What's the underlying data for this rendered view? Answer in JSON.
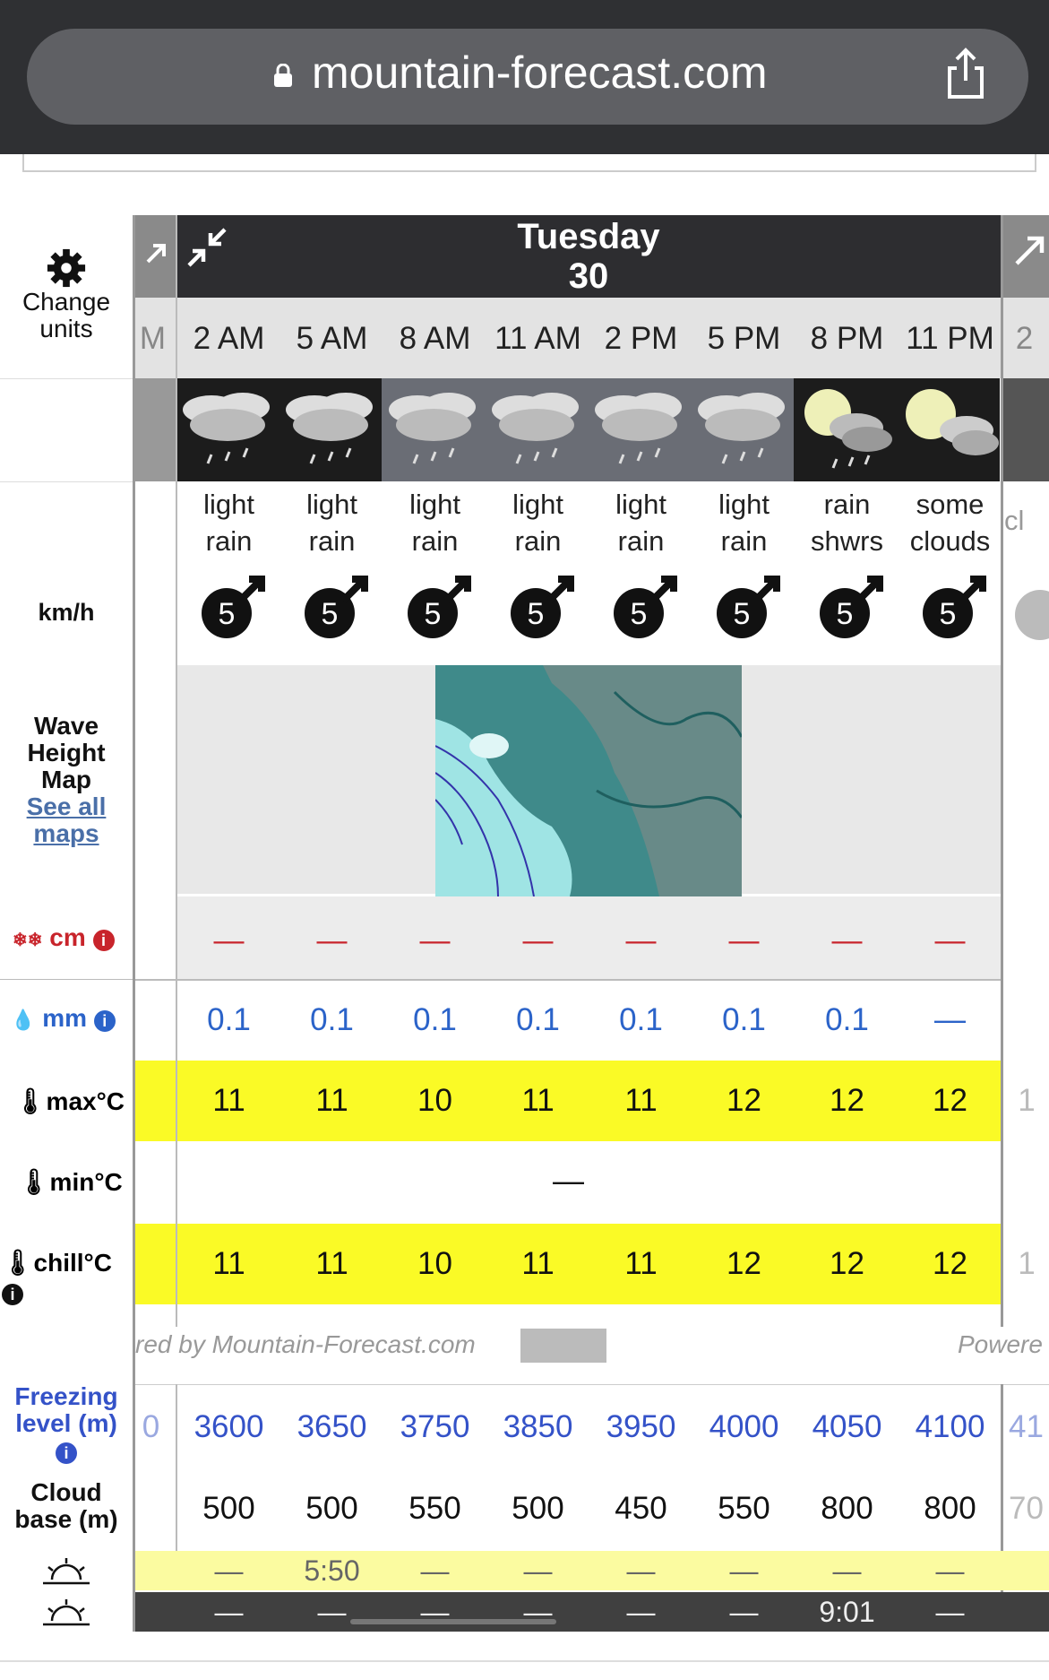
{
  "browser": {
    "url": "mountain-forecast.com"
  },
  "left_labels": {
    "change": "Change",
    "units": "units",
    "wind_unit": "km/h",
    "wave1": "Wave",
    "wave2": "Height",
    "wave3": "Map",
    "see_all1": "See all",
    "see_all2": "maps",
    "snow_unit": "cm",
    "rain_unit": "mm",
    "max_temp": "max°C",
    "min_temp": "min°C",
    "chill": "chill°C",
    "freezing1": "Freezing",
    "freezing2": "level (m)",
    "cloud1": "Cloud",
    "cloud2": "base (m)"
  },
  "day": {
    "name": "Tuesday",
    "number": "30"
  },
  "times": [
    "2 AM",
    "5 AM",
    "8 AM",
    "11 AM",
    "2 PM",
    "5 PM",
    "8 PM",
    "11 PM"
  ],
  "edge_labels": {
    "left_time": "M",
    "right_time": "2",
    "right_desc": "cl",
    "right_temp": "1",
    "left_freeze": "0",
    "right_freeze": "41",
    "right_cloud": "70"
  },
  "descriptions": [
    [
      "light",
      "rain"
    ],
    [
      "light",
      "rain"
    ],
    [
      "light",
      "rain"
    ],
    [
      "light",
      "rain"
    ],
    [
      "light",
      "rain"
    ],
    [
      "light",
      "rain"
    ],
    [
      "rain",
      "shwrs"
    ],
    [
      "some",
      "clouds"
    ]
  ],
  "wind_speeds": [
    "5",
    "5",
    "5",
    "5",
    "5",
    "5",
    "5",
    "5"
  ],
  "snow": [
    "—",
    "—",
    "—",
    "—",
    "—",
    "—",
    "—",
    "—"
  ],
  "rain": [
    "0.1",
    "0.1",
    "0.1",
    "0.1",
    "0.1",
    "0.1",
    "0.1",
    "—"
  ],
  "max_temp": [
    "11",
    "11",
    "10",
    "11",
    "11",
    "12",
    "12",
    "12"
  ],
  "min_temp": "—",
  "chill": [
    "11",
    "11",
    "10",
    "11",
    "11",
    "12",
    "12",
    "12"
  ],
  "powered_text": "red by Mountain-Forecast.com",
  "powered_right": "Powere",
  "freezing_level": [
    "3600",
    "3650",
    "3750",
    "3850",
    "3950",
    "4000",
    "4050",
    "4100"
  ],
  "cloud_base": [
    "500",
    "500",
    "550",
    "500",
    "450",
    "550",
    "800",
    "800"
  ],
  "sunrise": [
    "—",
    "5:50",
    "—",
    "—",
    "—",
    "—",
    "—",
    "—"
  ],
  "sunset": [
    "—",
    "—",
    "—",
    "—",
    "—",
    "—",
    "9:01",
    "—"
  ],
  "colors": {
    "highlight": "#fafa26",
    "freezing": "#3452c8",
    "rain": "#2b63c9",
    "snow": "#c8242b"
  }
}
